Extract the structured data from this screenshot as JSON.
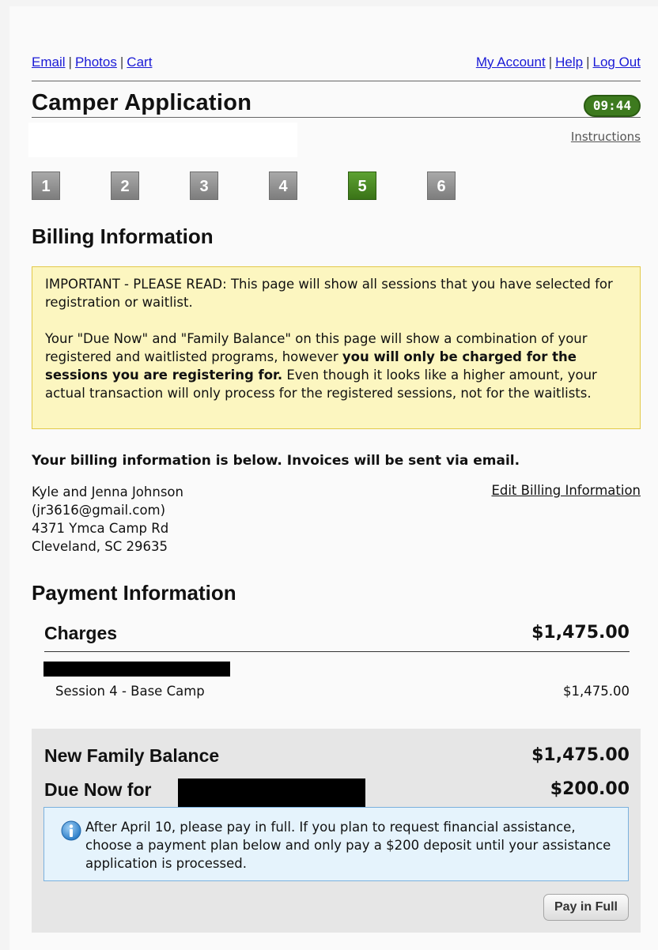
{
  "nav": {
    "left": [
      "Email",
      "Photos",
      "Cart"
    ],
    "right": [
      "My Account",
      "Help",
      "Log Out"
    ]
  },
  "header": {
    "title": "Camper Application",
    "timer": "09:44",
    "instructions": "Instructions"
  },
  "steps": [
    {
      "label": "1",
      "active": false
    },
    {
      "label": "2",
      "active": false
    },
    {
      "label": "3",
      "active": false
    },
    {
      "label": "4",
      "active": false
    },
    {
      "label": "5",
      "active": true
    },
    {
      "label": "6",
      "active": false
    }
  ],
  "billing": {
    "title": "Billing Information",
    "notice_p1": "IMPORTANT - PLEASE READ: This page will show all sessions that you have selected for registration or waitlist.",
    "notice_p2_start": "Your \"Due Now\" and \"Family Balance\" on this page will show a combination of your registered and waitlisted programs, however ",
    "notice_p2_bold": "you will only be charged for the sessions you are registering for.",
    "notice_p2_end": " Even though it looks like a higher amount, your actual transaction will only process for the registered sessions, not for the waitlists.",
    "info_heading": "Your billing information is below. Invoices will be sent via email.",
    "edit_link": "Edit Billing Information",
    "address_lines": [
      "Kyle and Jenna Johnson",
      "(jr3616@gmail.com)",
      "4371 Ymca Camp Rd",
      "Cleveland, SC 29635"
    ]
  },
  "payment": {
    "title": "Payment Information",
    "charges_label": "Charges",
    "charges_total": "$1,475.00",
    "session_name": "Session 4 - Base Camp",
    "session_amount": "$1,475.00",
    "new_balance_label": "New Family Balance",
    "new_balance_amount": "$1,475.00",
    "due_now_label": "Due Now for",
    "due_now_amount": "$200.00",
    "info_text": "After April 10, please pay in full. If you plan to request financial assistance, choose a payment plan below and only pay a $200 deposit until your assistance application is processed.",
    "pay_full_button": "Pay in Full"
  }
}
